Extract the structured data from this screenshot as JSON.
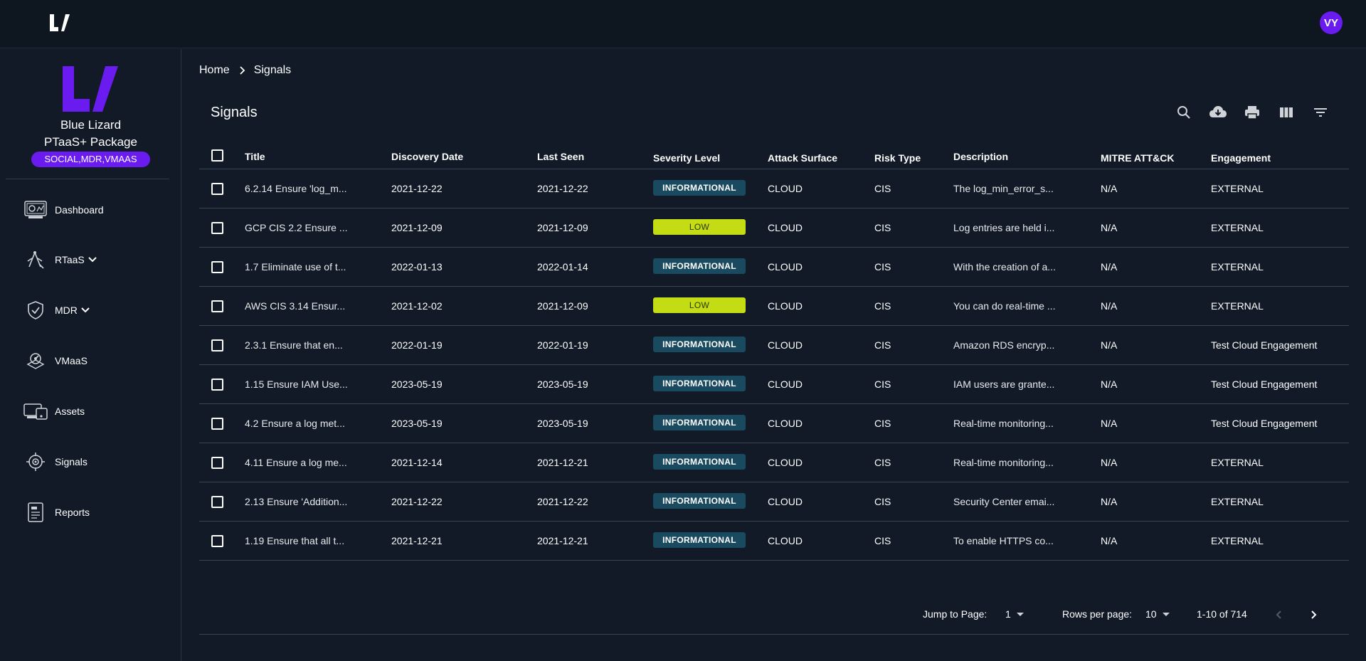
{
  "user": {
    "initials": "VY"
  },
  "colors": {
    "accent": "#6a1cf0",
    "informational": "#1a4a60",
    "low": "#c3dc14",
    "background": "#111a26"
  },
  "sidebar": {
    "org_name": "Blue Lizard",
    "package": "PTaaS+ Package",
    "package_badge": "SOCIAL,MDR,VMAAS",
    "items": [
      {
        "label": "Dashboard",
        "icon": "dashboard-icon"
      },
      {
        "label": "RTaaS",
        "icon": "rtaas-icon",
        "expandable": true
      },
      {
        "label": "MDR",
        "icon": "shield-check-icon",
        "expandable": true
      },
      {
        "label": "VMaaS",
        "icon": "vmaas-icon"
      },
      {
        "label": "Assets",
        "icon": "assets-icon"
      },
      {
        "label": "Signals",
        "icon": "target-icon"
      },
      {
        "label": "Reports",
        "icon": "report-icon"
      }
    ]
  },
  "breadcrumb": {
    "home": "Home",
    "current": "Signals"
  },
  "page": {
    "title": "Signals"
  },
  "toolbar": [
    "search-icon",
    "download-icon",
    "print-icon",
    "columns-icon",
    "filter-icon"
  ],
  "table": {
    "headers": {
      "title": "Title",
      "discovery_date": "Discovery Date",
      "last_seen": "Last Seen",
      "severity": "Severity Level",
      "attack_surface": "Attack Surface",
      "risk_type": "Risk Type",
      "description": "Description",
      "mitre": "MITRE ATT&CK",
      "engagement": "Engagement"
    },
    "rows": [
      {
        "title": "6.2.14 Ensure 'log_m...",
        "discovery": "2021-12-22",
        "last_seen": "2021-12-22",
        "severity": "INFORMATIONAL",
        "surface": "CLOUD",
        "risk": "CIS",
        "description": "The log_min_error_s...",
        "mitre": "N/A",
        "engagement": "EXTERNAL"
      },
      {
        "title": "GCP CIS 2.2 Ensure ...",
        "discovery": "2021-12-09",
        "last_seen": "2021-12-09",
        "severity": "LOW",
        "surface": "CLOUD",
        "risk": "CIS",
        "description": "Log entries are held i...",
        "mitre": "N/A",
        "engagement": "EXTERNAL"
      },
      {
        "title": "1.7 Eliminate use of t...",
        "discovery": "2022-01-13",
        "last_seen": "2022-01-14",
        "severity": "INFORMATIONAL",
        "surface": "CLOUD",
        "risk": "CIS",
        "description": "With the creation of a...",
        "mitre": "N/A",
        "engagement": "EXTERNAL"
      },
      {
        "title": "AWS CIS 3.14 Ensur...",
        "discovery": "2021-12-02",
        "last_seen": "2021-12-09",
        "severity": "LOW",
        "surface": "CLOUD",
        "risk": "CIS",
        "description": "You can do real-time ...",
        "mitre": "N/A",
        "engagement": "EXTERNAL"
      },
      {
        "title": "2.3.1 Ensure that en...",
        "discovery": "2022-01-19",
        "last_seen": "2022-01-19",
        "severity": "INFORMATIONAL",
        "surface": "CLOUD",
        "risk": "CIS",
        "description": "Amazon RDS encryp...",
        "mitre": "N/A",
        "engagement": "Test Cloud Engagement"
      },
      {
        "title": "1.15 Ensure IAM Use...",
        "discovery": "2023-05-19",
        "last_seen": "2023-05-19",
        "severity": "INFORMATIONAL",
        "surface": "CLOUD",
        "risk": "CIS",
        "description": "IAM users are grante...",
        "mitre": "N/A",
        "engagement": "Test Cloud Engagement"
      },
      {
        "title": "4.2 Ensure a log met...",
        "discovery": "2023-05-19",
        "last_seen": "2023-05-19",
        "severity": "INFORMATIONAL",
        "surface": "CLOUD",
        "risk": "CIS",
        "description": "Real-time monitoring...",
        "mitre": "N/A",
        "engagement": "Test Cloud Engagement"
      },
      {
        "title": "4.11 Ensure a log me...",
        "discovery": "2021-12-14",
        "last_seen": "2021-12-21",
        "severity": "INFORMATIONAL",
        "surface": "CLOUD",
        "risk": "CIS",
        "description": "Real-time monitoring...",
        "mitre": "N/A",
        "engagement": "EXTERNAL"
      },
      {
        "title": "2.13 Ensure 'Addition...",
        "discovery": "2021-12-22",
        "last_seen": "2021-12-22",
        "severity": "INFORMATIONAL",
        "surface": "CLOUD",
        "risk": "CIS",
        "description": "Security Center emai...",
        "mitre": "N/A",
        "engagement": "EXTERNAL"
      },
      {
        "title": "1.19 Ensure that all t...",
        "discovery": "2021-12-21",
        "last_seen": "2021-12-21",
        "severity": "INFORMATIONAL",
        "surface": "CLOUD",
        "risk": "CIS",
        "description": "To enable HTTPS co...",
        "mitre": "N/A",
        "engagement": "EXTERNAL"
      }
    ]
  },
  "pagination": {
    "jump_label": "Jump to Page:",
    "jump_value": "1",
    "rows_label": "Rows per page:",
    "rows_value": "10",
    "range": "1-10 of 714"
  }
}
